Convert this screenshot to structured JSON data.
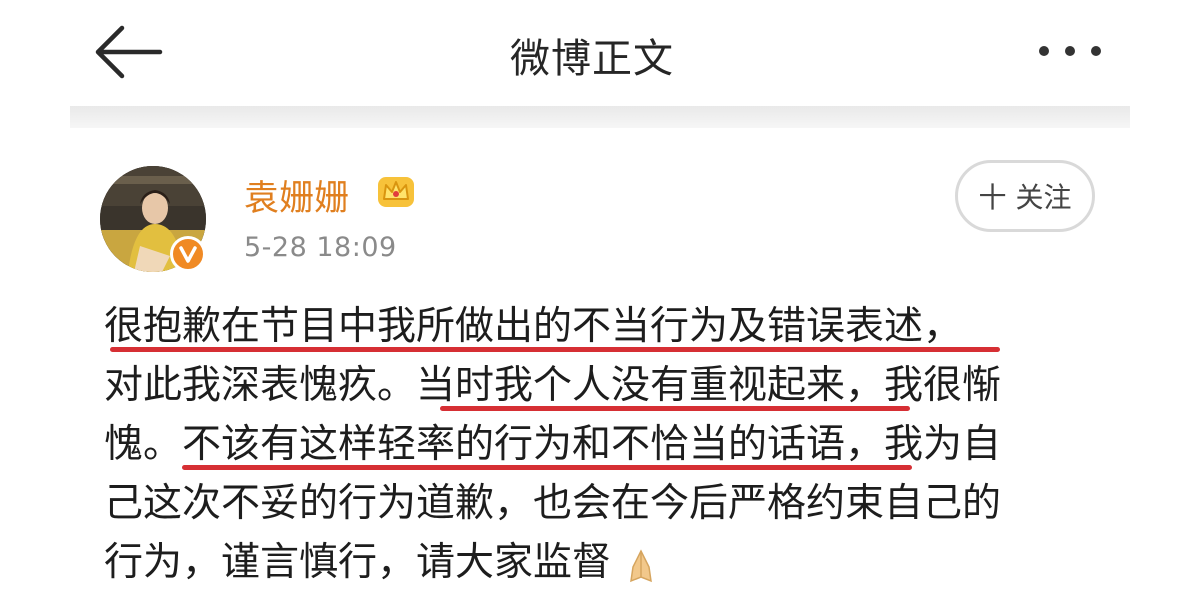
{
  "header": {
    "title": "微博正文",
    "back_icon": "arrow-left-icon",
    "more_icon": "more-dots-icon"
  },
  "post": {
    "username": "袁姗姗",
    "badge_icon": "crown-icon",
    "verified_icon": "verified-v-icon",
    "time": "5-28 18:09",
    "follow_label": "十 关注",
    "lines": [
      "很抱歉在节目中我所做出的不当行为及错误表述，",
      "对此我深表愧疚。当时我个人没有重视起来，我很惭",
      "愧。不该有这样轻率的行为和不恰当的话语，我为自",
      "己这次不妥的行为道歉，也会在今后严格约束自己的",
      "行为，谨言慎行，请大家监督"
    ],
    "trailing_emoji": "praying-hands-icon"
  },
  "colors": {
    "username": "#e07f1f",
    "underline": "#d62f34",
    "verified": "#f08a24"
  }
}
